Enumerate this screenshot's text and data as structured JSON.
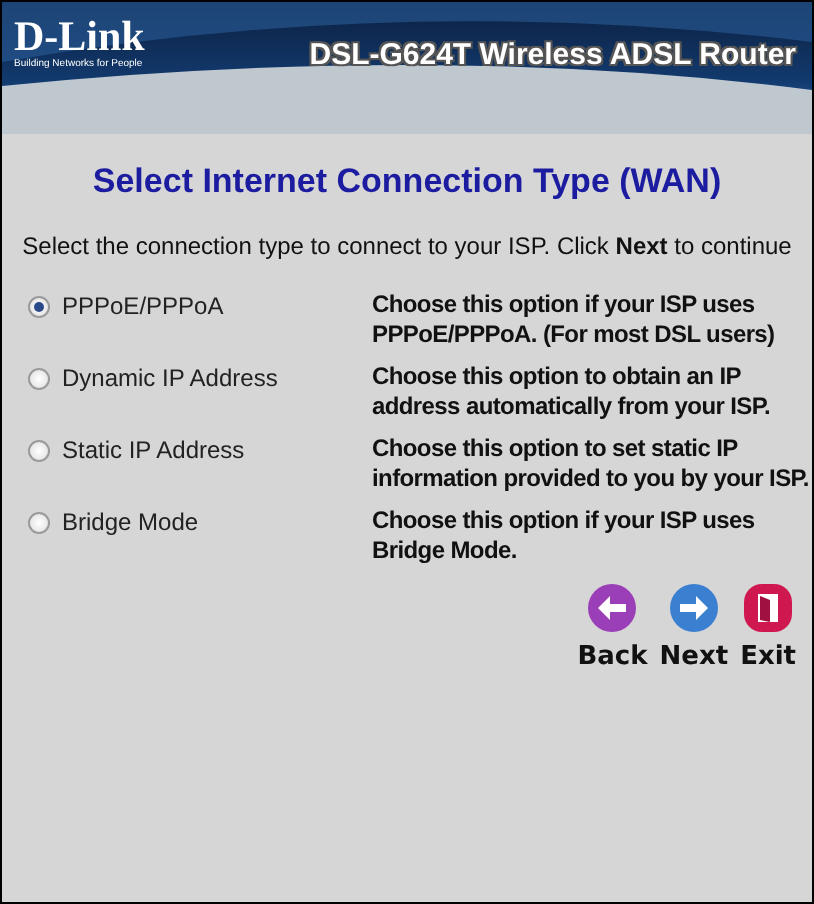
{
  "header": {
    "logo": "D-Link",
    "tagline": "Building Networks for People",
    "product": "DSL-G624T Wireless ADSL Router"
  },
  "title": "Select Internet Connection Type (WAN)",
  "instruction": "Select the connection type to connect to your ISP. Click **Next** to continue",
  "options": [
    {
      "label": "PPPoE/PPPoA",
      "description": "Choose this option if your ISP uses PPPoE/PPPoA. (For most DSL users)",
      "selected": true
    },
    {
      "label": "Dynamic IP Address",
      "description": "Choose this option to obtain an IP address automatically from your ISP.",
      "selected": false
    },
    {
      "label": "Static IP Address",
      "description": "Choose this option to set static IP information provided to you by your ISP.",
      "selected": false
    },
    {
      "label": "Bridge Mode",
      "description": "Choose this option if your ISP uses Bridge Mode.",
      "selected": false
    }
  ],
  "buttons": [
    {
      "kind": "back",
      "label": "Back"
    },
    {
      "kind": "next",
      "label": "Next"
    },
    {
      "kind": "exit",
      "label": "Exit"
    }
  ]
}
